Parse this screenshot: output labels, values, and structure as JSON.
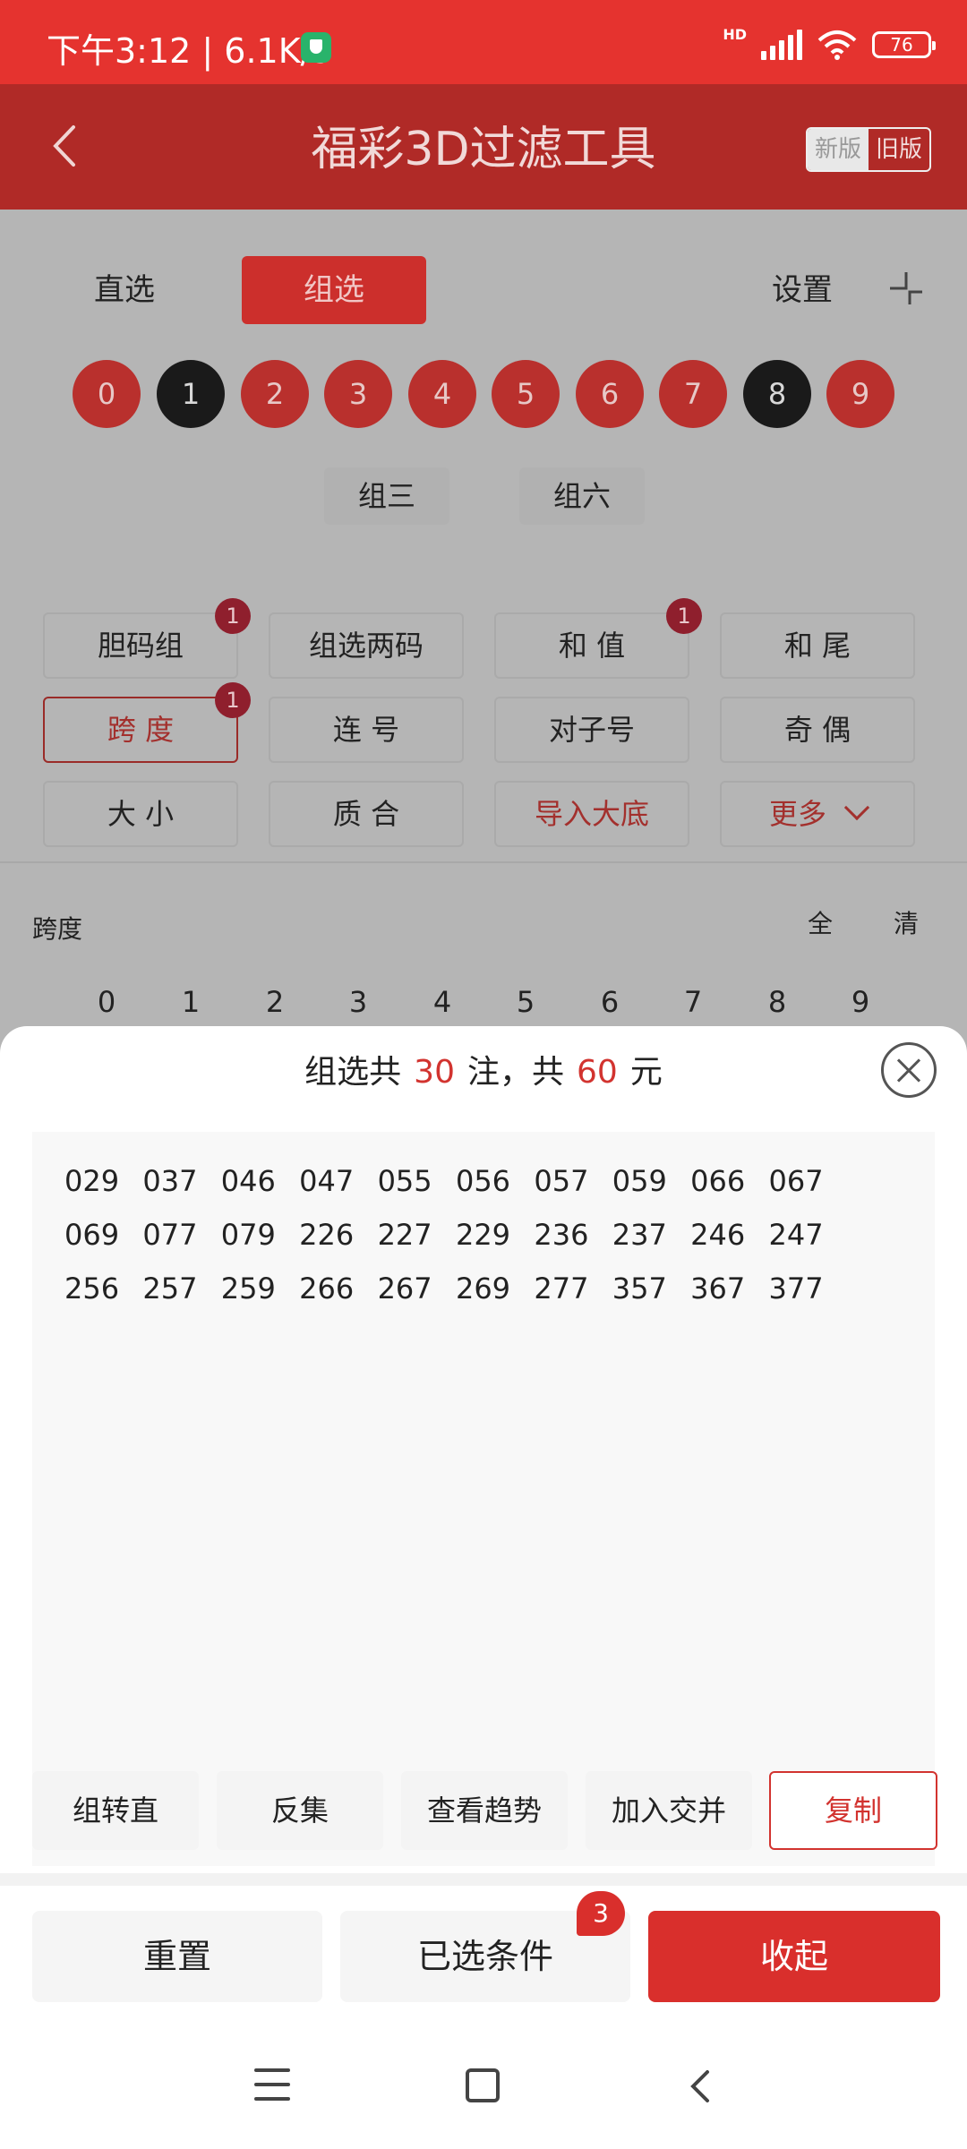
{
  "status_bar": {
    "time_speed": "下午3:12 | 6.1K/s",
    "network": "HD",
    "battery": "76"
  },
  "header": {
    "title": "福彩3D过滤工具",
    "version_new": "新版",
    "version_old": "旧版"
  },
  "mode_tabs": {
    "direct": "直选",
    "group": "组选",
    "settings": "设置"
  },
  "digits": [
    {
      "label": "0",
      "state": "red"
    },
    {
      "label": "1",
      "state": "black"
    },
    {
      "label": "2",
      "state": "red"
    },
    {
      "label": "3",
      "state": "red"
    },
    {
      "label": "4",
      "state": "red"
    },
    {
      "label": "5",
      "state": "red"
    },
    {
      "label": "6",
      "state": "red"
    },
    {
      "label": "7",
      "state": "red"
    },
    {
      "label": "8",
      "state": "black"
    },
    {
      "label": "9",
      "state": "red"
    }
  ],
  "group_options": {
    "group3": "组三",
    "group6": "组六"
  },
  "filters": {
    "dan_ma_zu": "胆码组",
    "dan_ma_zu_badge": "1",
    "zu_xuan_liang_ma": "组选两码",
    "he_zhi": "和 值",
    "he_zhi_badge": "1",
    "he_wei": "和 尾",
    "kua_du": "跨 度",
    "kua_du_badge": "1",
    "lian_hao": "连 号",
    "dui_zi_hao": "对子号",
    "ji_ou": "奇 偶",
    "da_xiao": "大 小",
    "zhi_he": "质 合",
    "import_base": "导入大底",
    "more": "更多"
  },
  "span_section": {
    "label": "跨度",
    "select_all": "全",
    "clear": "清",
    "digits": [
      "0",
      "1",
      "2",
      "3",
      "4",
      "5",
      "6",
      "7",
      "8",
      "9"
    ]
  },
  "sheet": {
    "summary_prefix": "组选共",
    "bet_count": "30",
    "summary_mid": "注，共",
    "amount": "60",
    "summary_suffix": "元",
    "results": [
      "029",
      "037",
      "046",
      "047",
      "055",
      "056",
      "057",
      "059",
      "066",
      "067",
      "069",
      "077",
      "079",
      "226",
      "227",
      "229",
      "236",
      "237",
      "246",
      "247",
      "256",
      "257",
      "259",
      "266",
      "267",
      "269",
      "277",
      "357",
      "367",
      "377"
    ],
    "actions": {
      "to_direct": "组转直",
      "inverse": "反集",
      "trend": "查看趋势",
      "intersect": "加入交并",
      "copy": "复制"
    }
  },
  "bottom_bar": {
    "reset": "重置",
    "selected_conditions": "已选条件",
    "conditions_count": "3",
    "collapse": "收起"
  },
  "colors": {
    "primary_red": "#d92f2c",
    "header_red": "#b02a27",
    "highlight_text": "#d2332f"
  }
}
